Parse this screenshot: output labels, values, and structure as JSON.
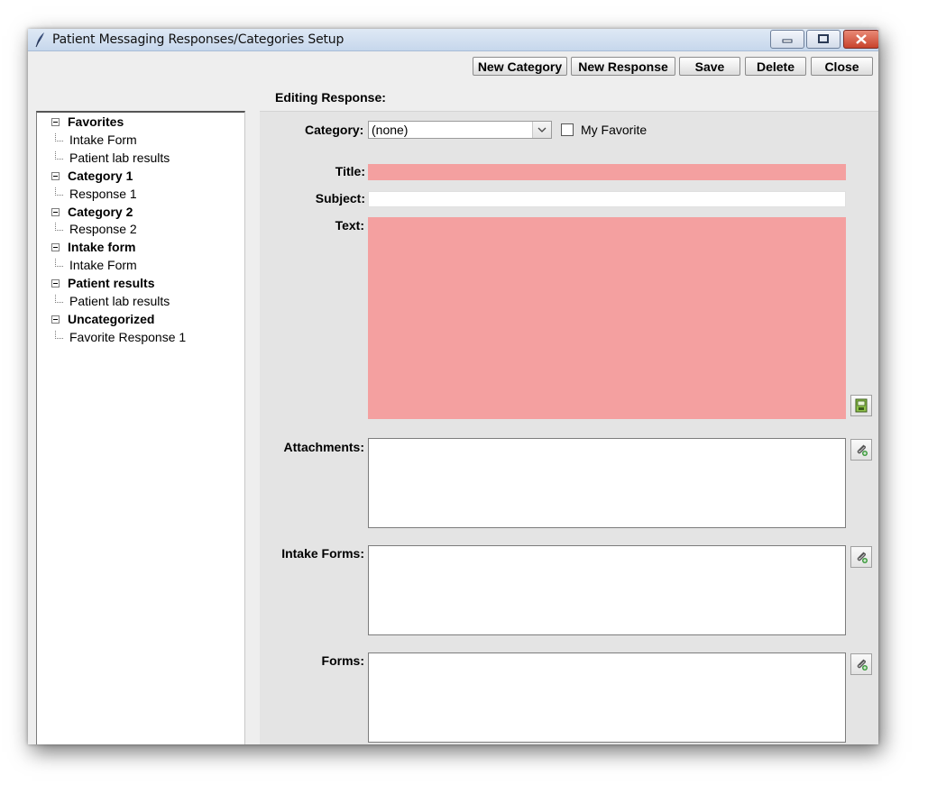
{
  "window": {
    "title": "Patient Messaging Responses/Categories Setup"
  },
  "toolbar": {
    "new_category": "New Category",
    "new_response": "New Response",
    "save": "Save",
    "delete": "Delete",
    "close": "Close"
  },
  "editing_label": "Editing Response:",
  "tree": {
    "categories": [
      {
        "label": "Favorites",
        "items": [
          "Intake Form",
          "Patient lab results"
        ]
      },
      {
        "label": "Category 1",
        "items": [
          "Response 1"
        ]
      },
      {
        "label": "Category 2",
        "items": [
          "Response 2"
        ]
      },
      {
        "label": "Intake form",
        "items": [
          "Intake Form"
        ]
      },
      {
        "label": "Patient results",
        "items": [
          "Patient lab results"
        ]
      },
      {
        "label": "Uncategorized",
        "items": [
          "Favorite Response 1"
        ]
      }
    ]
  },
  "form": {
    "category_label": "Category:",
    "category_value": "(none)",
    "my_favorite_label": "My Favorite",
    "title_label": "Title:",
    "title_value": "",
    "subject_label": "Subject:",
    "subject_value": "",
    "text_label": "Text:",
    "text_value": "",
    "attachments_label": "Attachments:",
    "intake_forms_label": "Intake Forms:",
    "forms_label": "Forms:"
  },
  "colors": {
    "required_field": "#f4a0a0",
    "panel": "#e4e4e4",
    "titlebar": "#c6d7ec"
  },
  "icons": {
    "app": "feather-icon",
    "text_side": "insert-template-icon",
    "attach": "paperclip-add-icon"
  }
}
